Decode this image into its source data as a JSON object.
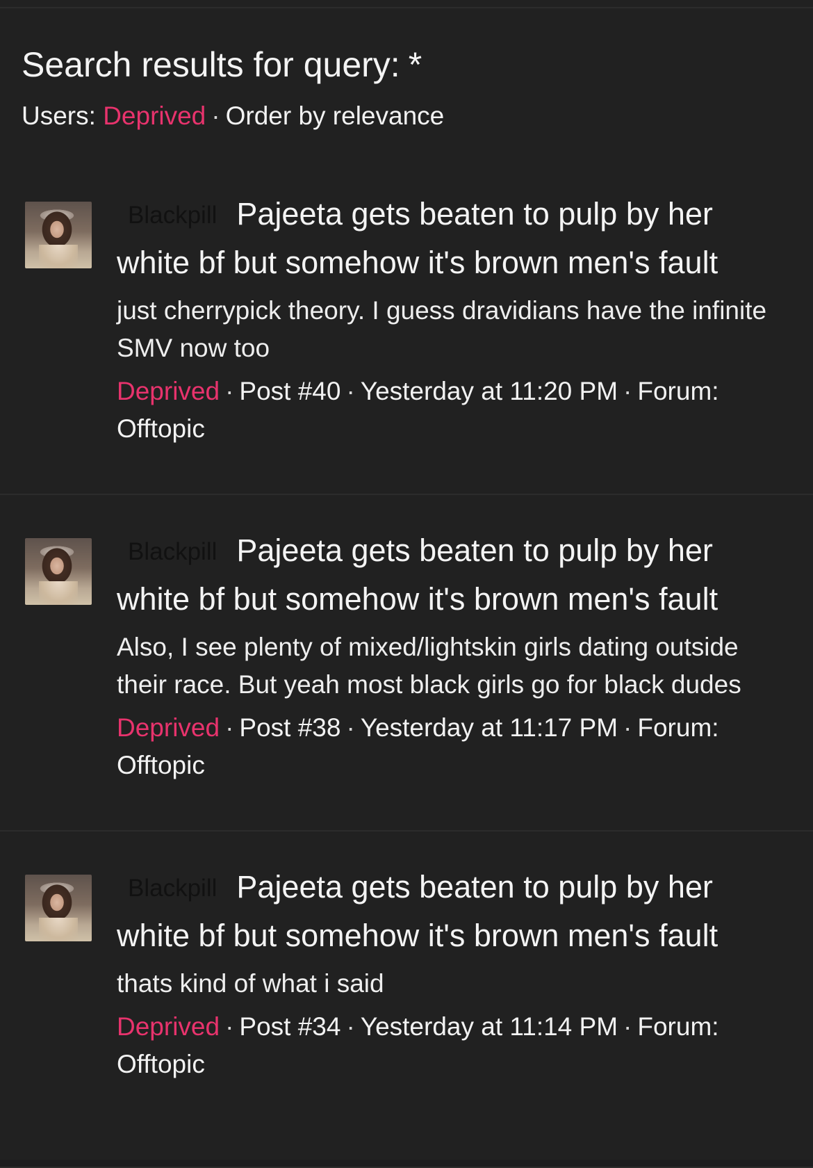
{
  "header": {
    "title": "Search results for query:",
    "query": "*",
    "users_label": "Users:",
    "user": "Deprived",
    "separator": "·",
    "order": "Order by relevance"
  },
  "colors": {
    "accent": "#e8336d",
    "background": "#212121",
    "text": "#f2f2f2"
  },
  "results": [
    {
      "prefix": "Blackpill",
      "title": "Pajeeta gets beaten to pulp by her white bf but somehow it's brown men's fault",
      "snippet": "just cherrypick theory. I guess dravidians have the infinite SMV now too",
      "author": "Deprived",
      "post": "Post #40",
      "time": "Yesterday at 11:20 PM",
      "forum": "Forum: Offtopic"
    },
    {
      "prefix": "Blackpill",
      "title": "Pajeeta gets beaten to pulp by her white bf but somehow it's brown men's fault",
      "snippet": "Also, I see plenty of mixed/lightskin girls dating outside their race. But yeah most black girls go for black dudes",
      "author": "Deprived",
      "post": "Post #38",
      "time": "Yesterday at 11:17 PM",
      "forum": "Forum: Offtopic"
    },
    {
      "prefix": "Blackpill",
      "title": "Pajeeta gets beaten to pulp by her white bf but somehow it's brown men's fault",
      "snippet": "thats kind of what i said",
      "author": "Deprived",
      "post": "Post #34",
      "time": "Yesterday at 11:14 PM",
      "forum": "Forum: Offtopic"
    }
  ]
}
